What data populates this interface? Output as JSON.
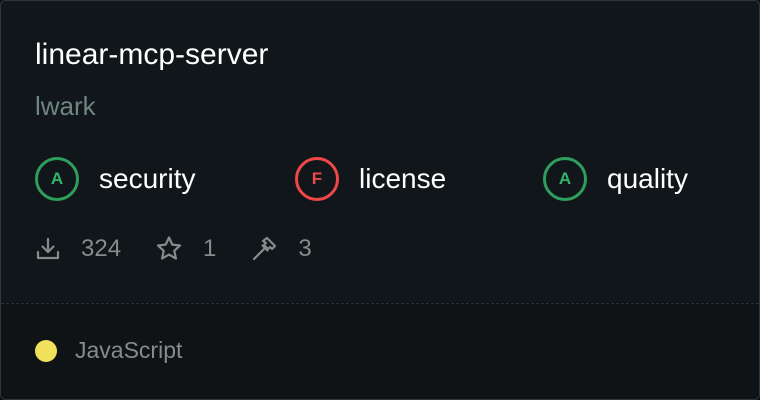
{
  "repo": {
    "name": "linear-mcp-server",
    "owner": "lwark"
  },
  "grades": [
    {
      "letter": "A",
      "label": "security",
      "status": "pass",
      "color": "#2f9e5c"
    },
    {
      "letter": "F",
      "label": "license",
      "status": "fail",
      "color": "#f04848"
    },
    {
      "letter": "A",
      "label": "quality",
      "status": "pass",
      "color": "#2f9e5c"
    }
  ],
  "stats": {
    "downloads": "324",
    "stars": "1",
    "tools": "3"
  },
  "language": {
    "name": "JavaScript",
    "color": "#f1e05a"
  },
  "icons": {
    "downloads": "download-icon",
    "stars": "star-icon",
    "tools": "hammer-icon"
  }
}
